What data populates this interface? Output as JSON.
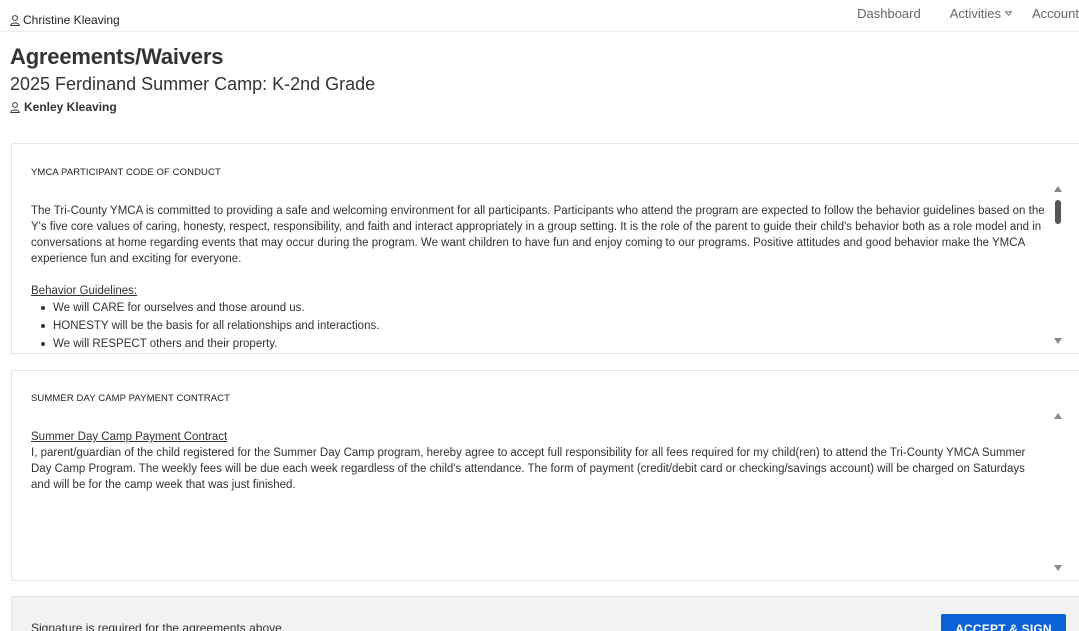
{
  "header": {
    "user_name": "Christine Kleaving",
    "nav": [
      {
        "label": "Dashboard"
      },
      {
        "label": "Activities"
      },
      {
        "label": "Account"
      }
    ]
  },
  "page": {
    "title": "Agreements/Waivers",
    "program": "2025 Ferdinand Summer Camp: K-2nd Grade",
    "participant": "Kenley Kleaving"
  },
  "agreements": [
    {
      "title": "YMCA PARTICIPANT CODE OF CONDUCT",
      "paragraph": "The Tri-County YMCA is committed to providing a safe and welcoming environment for all participants.  Participants who attend the program are expected to follow the behavior guidelines based on the Y's five core values of caring, honesty, respect, responsibility, and faith and interact appropriately in a group setting.  It is the role of the parent to guide their child's behavior both as a role model and in conversations at home regarding events that may occur during the program. We want children to have fun and enjoy coming to our programs.  Positive attitudes and good behavior make the YMCA experience fun and exciting for everyone.",
      "subhead": "Behavior Guidelines:",
      "bullets": [
        "We will CARE for ourselves and those around us.",
        "HONESTY will be the basis for all relationships and interactions.",
        "We will RESPECT others and their property."
      ]
    },
    {
      "title": "SUMMER DAY CAMP PAYMENT CONTRACT",
      "subhead": "Summer Day Camp Payment Contract",
      "paragraph": "I, parent/guardian of the child registered for the Summer Day Camp program, hereby agree to accept full responsibility for all fees required for my child(ren) to attend the Tri-County YMCA Summer Day Camp Program.  The weekly fees will be due each week regardless of the child's attendance.  The form of payment (credit/debit card or checking/savings account) will be charged on Saturdays and will be for the camp week that was just finished."
    }
  ],
  "footer": {
    "note": "Signature is required for the agreements above.",
    "accept_label": "ACCEPT & SIGN"
  },
  "colors": {
    "accent": "#0b62d6",
    "footer_bg": "#f2f2f2"
  }
}
